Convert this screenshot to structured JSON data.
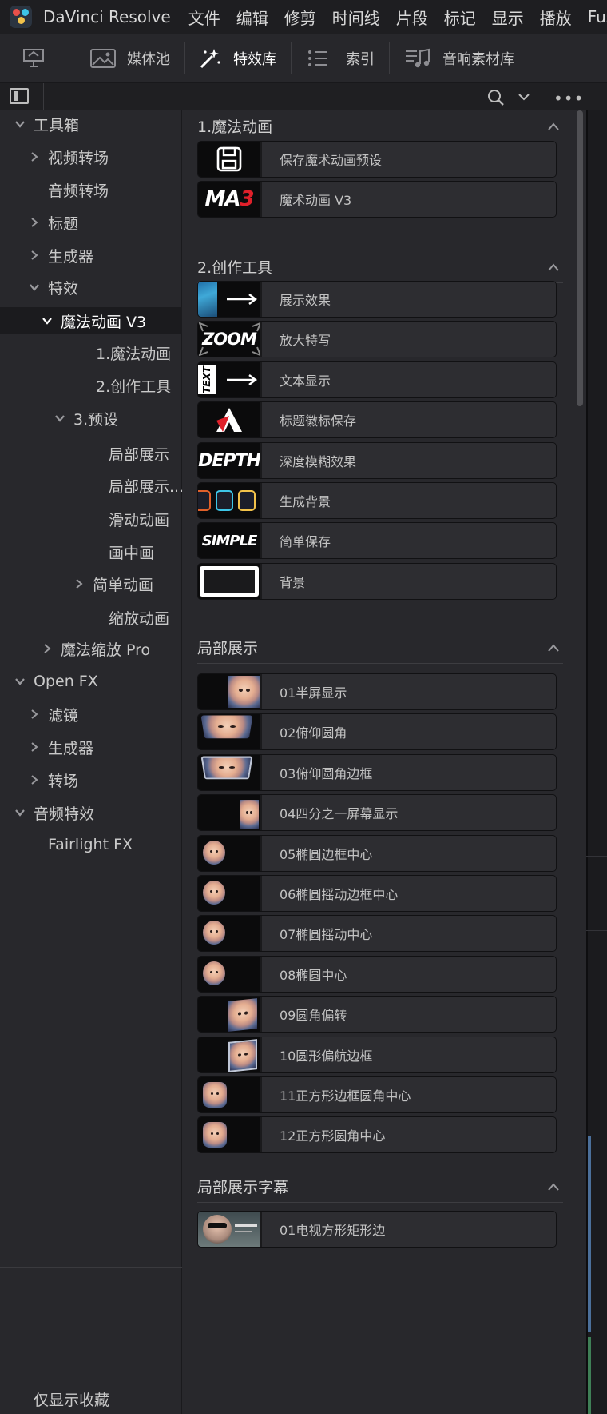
{
  "menubar": {
    "app_title": "DaVinci Resolve",
    "items": [
      "文件",
      "编辑",
      "修剪",
      "时间线",
      "片段",
      "标记",
      "显示",
      "播放",
      "Fus"
    ]
  },
  "toolbar": {
    "media_pool": "媒体池",
    "effects": "特效库",
    "index": "索引",
    "sound_library": "音响素材库"
  },
  "sidebar": {
    "items": [
      {
        "label": "工具箱",
        "caret": "down"
      },
      {
        "label": "视频转场",
        "caret": "right"
      },
      {
        "label": "音频转场",
        "caret": ""
      },
      {
        "label": "标题",
        "caret": "right"
      },
      {
        "label": "生成器",
        "caret": "right"
      },
      {
        "label": "特效",
        "caret": "down"
      },
      {
        "label": "魔法动画 V3",
        "caret": "down"
      },
      {
        "label": "1.魔法动画",
        "caret": ""
      },
      {
        "label": "2.创作工具",
        "caret": ""
      },
      {
        "label": "3.预设",
        "caret": "down"
      },
      {
        "label": "局部展示",
        "caret": ""
      },
      {
        "label": "局部展示...",
        "caret": ""
      },
      {
        "label": "滑动动画",
        "caret": ""
      },
      {
        "label": "画中画",
        "caret": ""
      },
      {
        "label": "简单动画",
        "caret": "right"
      },
      {
        "label": "缩放动画",
        "caret": ""
      },
      {
        "label": "魔法缩放 Pro",
        "caret": "right"
      },
      {
        "label": "Open FX",
        "caret": "down"
      },
      {
        "label": "滤镜",
        "caret": "right"
      },
      {
        "label": "生成器",
        "caret": "right"
      },
      {
        "label": "转场",
        "caret": "right"
      },
      {
        "label": "音频特效",
        "caret": "down"
      },
      {
        "label": "Fairlight FX",
        "caret": ""
      }
    ],
    "favorites_label": "仅显示收藏"
  },
  "sections": [
    {
      "title": "1.魔法动画",
      "items": [
        "保存魔术动画预设",
        "魔术动画 V3"
      ]
    },
    {
      "title": "2.创作工具",
      "items": [
        "展示效果",
        "放大特写",
        "文本显示",
        "标题徽标保存",
        "深度模糊效果",
        "生成背景",
        "简单保存",
        "背景"
      ]
    },
    {
      "title": "局部展示",
      "items": [
        "01半屏显示",
        "02俯仰圆角",
        "03俯仰圆角边框",
        "04四分之一屏幕显示",
        "05椭圆边框中心",
        "06椭圆摇动边框中心",
        "07椭圆摇动中心",
        "08椭圆中心",
        "09圆角偏转",
        "10圆形偏航边框",
        "11正方形边框圆角中心",
        "12正方形圆角中心"
      ]
    },
    {
      "title": "局部展示字幕",
      "items": [
        "01电视方形矩形边"
      ]
    }
  ],
  "thumb_text": {
    "ma": "MA",
    "three": "3",
    "zoom": "ZOOM",
    "text": "TEXT",
    "depth": "DEPTH",
    "simple": "SIMPLE"
  },
  "colors": {
    "accent_red": "#e0202a",
    "selected_bg": "#1b1b1e",
    "panel_bg": "#28282c"
  }
}
